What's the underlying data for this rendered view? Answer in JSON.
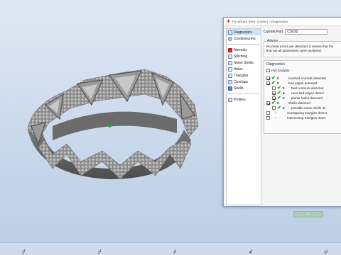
{
  "window": {
    "title": "Fix Wizard (Part: CS092) > Diagnostics"
  },
  "sidebar": {
    "items": [
      {
        "label": "Diagnostics",
        "icon": "wizard-icon",
        "selected": true
      },
      {
        "label": "Combined Fix",
        "icon": "wrench-icon"
      }
    ],
    "tools": [
      {
        "label": "Normals",
        "icon": "normals-icon"
      },
      {
        "label": "Stitching",
        "icon": "stitching-icon"
      },
      {
        "label": "Noise Shells",
        "icon": "noise-shells-icon"
      },
      {
        "label": "Holes",
        "icon": "holes-icon"
      },
      {
        "label": "Triangles",
        "icon": "triangles-icon"
      },
      {
        "label": "Overlaps",
        "icon": "overlaps-icon"
      },
      {
        "label": "Shells",
        "icon": "shells-icon"
      }
    ],
    "profiles": {
      "label": "Profiles",
      "icon": "profiles-icon"
    }
  },
  "part": {
    "label": "Current Part",
    "value": "CS092"
  },
  "advice": {
    "title": "Advice",
    "line1": "No more errors are detected. It seems that the",
    "line2": "that not all parameters were analysed."
  },
  "diagnostics": {
    "title": "Diagnostics",
    "full_analysis": "Full Analysis",
    "rows": [
      {
        "label": "inverted normals detected",
        "value": "0",
        "level": 0,
        "checked": true
      },
      {
        "label": "bad edges detected",
        "value": "0",
        "level": 0,
        "checked": true
      },
      {
        "label": "bad contours detected",
        "value": "0",
        "level": 1,
        "checked": false
      },
      {
        "label": "near bad edges detect",
        "value": "0",
        "level": 1,
        "checked": true
      },
      {
        "label": "planar holes detected",
        "value": "0",
        "level": 1,
        "checked": true
      },
      {
        "label": "shells detected",
        "value": "5",
        "level": 0,
        "checked": true
      },
      {
        "label": "possible noise shells de",
        "value": "0",
        "level": 1,
        "checked": false
      },
      {
        "label": "overlapping triangles detect",
        "value": "•",
        "level": 0,
        "checked": false
      },
      {
        "label": "intersecting triangles detec",
        "value": "•",
        "level": 0,
        "checked": false
      }
    ]
  },
  "ruler": {
    "labels": [
      "1",
      "2",
      "3",
      "4",
      "5"
    ]
  },
  "colors": {
    "accent_check": "#1a9a2a",
    "selection": "#cce2f8",
    "viewport_bg": "#c8d7ea"
  }
}
